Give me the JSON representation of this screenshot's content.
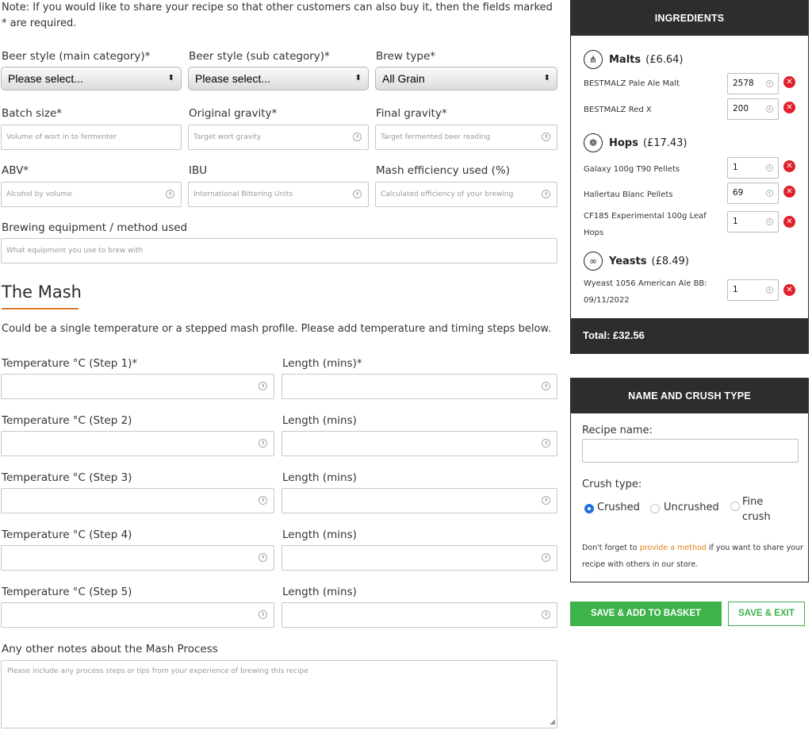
{
  "note": "Note: If you would like to share your recipe so that other customers can also buy it, then the fields marked * are required.",
  "form": {
    "main_category": {
      "label": "Beer style (main category)*",
      "value": "Please select..."
    },
    "sub_category": {
      "label": "Beer style (sub category)*",
      "value": "Please select..."
    },
    "brew_type": {
      "label": "Brew type*",
      "value": "All Grain"
    },
    "batch_size": {
      "label": "Batch size*",
      "placeholder": "Volume of wort in to fermenter"
    },
    "original_gravity": {
      "label": "Original gravity*",
      "placeholder": "Target wort gravity"
    },
    "final_gravity": {
      "label": "Final gravity*",
      "placeholder": "Target fermented beer reading"
    },
    "abv": {
      "label": "ABV*",
      "placeholder": "Alcohol by volume"
    },
    "ibu": {
      "label": "IBU",
      "placeholder": "International Bittering Units"
    },
    "mash_efficiency": {
      "label": "Mash efficiency used (%)",
      "placeholder": "Calculated efficiency of your brewing"
    },
    "equipment": {
      "label": "Brewing equipment / method used",
      "placeholder": "What equipment you use to brew with"
    }
  },
  "mash": {
    "heading": "The Mash",
    "intro": "Could be a single temperature or a stepped mash profile. Please add temperature and timing steps below.",
    "steps": [
      {
        "temp_label": "Temperature °C (Step 1)*",
        "length_label": "Length (mins)*"
      },
      {
        "temp_label": "Temperature °C (Step 2)",
        "length_label": "Length (mins)"
      },
      {
        "temp_label": "Temperature °C (Step 3)",
        "length_label": "Length (mins)"
      },
      {
        "temp_label": "Temperature °C (Step 4)",
        "length_label": "Length (mins)"
      },
      {
        "temp_label": "Temperature °C (Step 5)",
        "length_label": "Length (mins)"
      }
    ],
    "notes_label": "Any other notes about the Mash Process",
    "notes_placeholder": "Please include any process steps or tips from your experience of brewing this recipe"
  },
  "ingredients": {
    "title": "INGREDIENTS",
    "malts": {
      "name": "Malts",
      "price": "(£6.64)",
      "icon": "wheat-icon",
      "items": [
        {
          "name": "BESTMALZ Pale Ale Malt",
          "qty": "2578"
        },
        {
          "name": "BESTMALZ Red X",
          "qty": "200"
        }
      ]
    },
    "hops": {
      "name": "Hops",
      "price": "(£17.43)",
      "icon": "hop-icon",
      "items": [
        {
          "name": "Galaxy 100g T90 Pellets",
          "qty": "1"
        },
        {
          "name": "Hallertau Blanc Pellets",
          "qty": "69"
        },
        {
          "name": "CF185 Experimental 100g Leaf Hops",
          "qty": "1"
        }
      ]
    },
    "yeasts": {
      "name": "Yeasts",
      "price": "(£8.49)",
      "icon": "yeast-icon",
      "items": [
        {
          "name": "Wyeast 1056 American Ale BB: 09/11/2022",
          "qty": "1"
        }
      ]
    },
    "total": "Total: £32.56"
  },
  "name_crush": {
    "title": "NAME AND CRUSH TYPE",
    "recipe_name_label": "Recipe name:",
    "crush_label": "Crush type:",
    "options": [
      "Crushed",
      "Uncrushed",
      "Fine crush"
    ],
    "selected": "Crushed",
    "help_pre": "Don't forget to ",
    "help_link": "provide a method",
    "help_post": " if you want to share your recipe with others in our store."
  },
  "buttons": {
    "save_add": "SAVE & ADD TO BASKET",
    "save_exit": "SAVE & EXIT"
  },
  "colors": {
    "accent": "#e07b2a",
    "green": "#3db34a",
    "dark": "#2d2d2d",
    "remove": "#e0202b",
    "radio": "#1f6fe0"
  }
}
